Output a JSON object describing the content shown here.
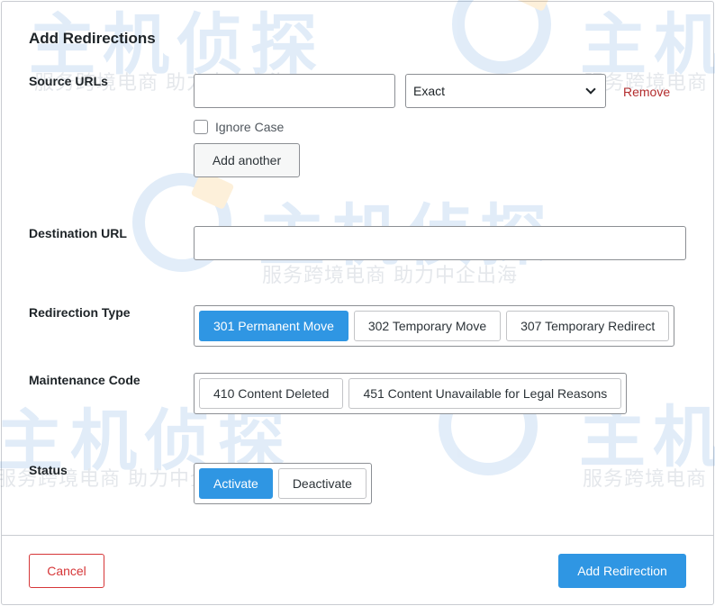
{
  "dialog": {
    "title": "Add Redirections"
  },
  "source": {
    "label": "Source URLs",
    "url_value": "",
    "match_select": "Exact",
    "remove_label": "Remove",
    "ignore_case_label": "Ignore Case",
    "ignore_case_checked": false,
    "add_another_label": "Add another"
  },
  "destination": {
    "label": "Destination URL",
    "value": ""
  },
  "redirection_type": {
    "label": "Redirection Type",
    "options": [
      "301 Permanent Move",
      "302 Temporary Move",
      "307 Temporary Redirect"
    ],
    "selected": "301 Permanent Move"
  },
  "maintenance": {
    "label": "Maintenance Code",
    "options": [
      "410 Content Deleted",
      "451 Content Unavailable for Legal Reasons"
    ]
  },
  "status": {
    "label": "Status",
    "options": [
      "Activate",
      "Deactivate"
    ],
    "selected": "Activate"
  },
  "footer": {
    "cancel_label": "Cancel",
    "submit_label": "Add Redirection"
  },
  "watermark": {
    "brand": "主机侦探",
    "tagline": "服务跨境电商 助力中企出海"
  },
  "colors": {
    "primary": "#2f96e3",
    "danger": "#d63638",
    "remove": "#b32d2e"
  }
}
